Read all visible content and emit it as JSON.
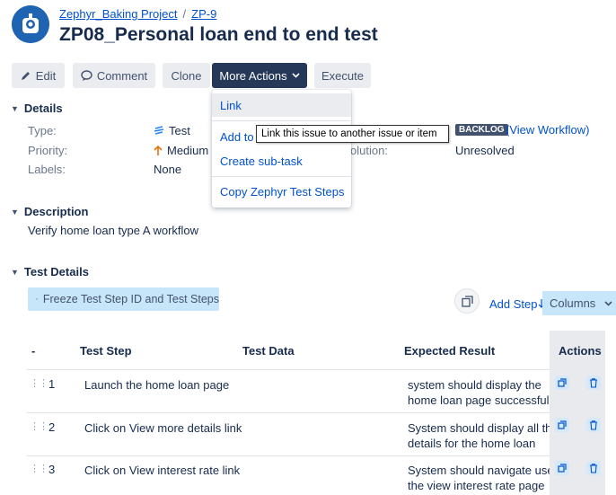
{
  "header": {
    "project_link": "Zephyr_Baking Project",
    "separator": "/",
    "issue_key": "ZP-9",
    "title": "ZP08_Personal loan end to end test"
  },
  "toolbar": {
    "edit_label": "Edit",
    "comment_label": "Comment",
    "clone_label": "Clone",
    "more_actions_label": "More Actions",
    "execute_label": "Execute"
  },
  "more_actions_menu": {
    "items": [
      "Link",
      "Add to",
      "Create sub-task",
      "Copy Zephyr Test Steps"
    ]
  },
  "tooltip": "Link this issue to another issue or item",
  "details": {
    "heading": "Details",
    "type_label": "Type:",
    "type_value": "Test",
    "priority_label": "Priority:",
    "priority_value": "Medium",
    "labels_label": "Labels:",
    "labels_value": "None",
    "status_badge": "BACKLOG",
    "view_workflow_open": "(",
    "view_workflow": "View Workflow",
    "view_workflow_close": ")",
    "resolution_label_partial": "olution:",
    "resolution_value": "Unresolved"
  },
  "description": {
    "heading": "Description",
    "text": "Verify home loan type A workflow"
  },
  "test_details": {
    "heading": "Test Details",
    "freeze_button": "Freeze Test Step ID and Test Steps",
    "add_step": "Add Step",
    "columns_button": "Columns",
    "columns": [
      "-",
      "Test Step",
      "Test Data",
      "Expected Result",
      "Actions"
    ],
    "rows": [
      {
        "num": "1",
        "step": "Launch the home loan page",
        "data": "",
        "expected_1": "system should display the",
        "expected_2": "home loan page successfully"
      },
      {
        "num": "2",
        "step": "Click on View more details link",
        "data": "",
        "expected_1": "System should display all the",
        "expected_2": "details for the home loan"
      },
      {
        "num": "3",
        "step": "Click on View interest rate link",
        "data": "",
        "expected_1": "System should navigate use",
        "expected_2": "the view interest rate page"
      }
    ]
  },
  "colors": {
    "accent": "#0052cc",
    "dark_button": "#253858",
    "light_blue_button": "#c8e6fa",
    "status_badge": "#42526e"
  }
}
